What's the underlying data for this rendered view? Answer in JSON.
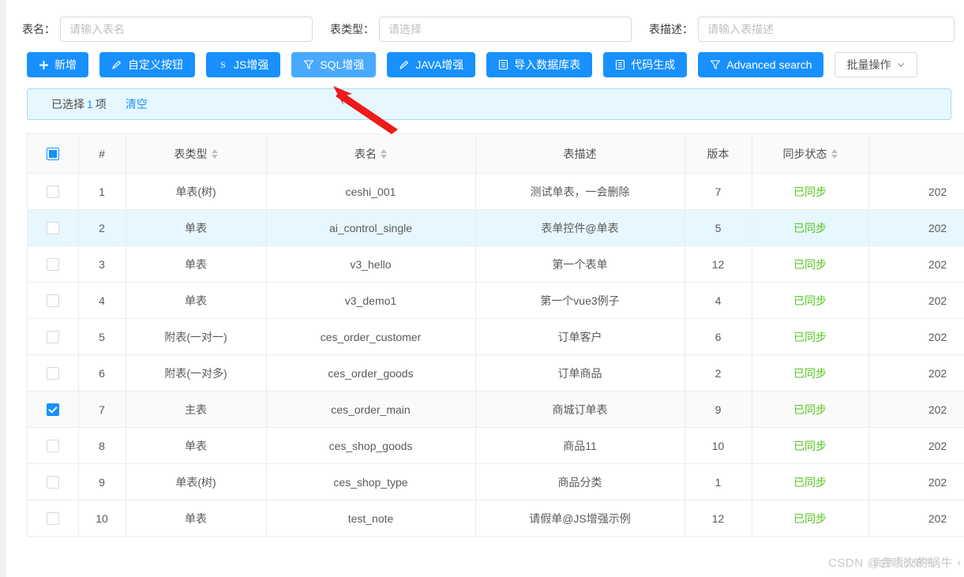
{
  "search_form": {
    "fields": [
      {
        "label": "表名：",
        "placeholder": "请输入表名",
        "value": "",
        "type": "input"
      },
      {
        "label": "表类型：",
        "placeholder": "请选择",
        "value": "",
        "type": "select"
      },
      {
        "label": "表描述：",
        "placeholder": "请输入表描述",
        "value": "",
        "type": "input"
      }
    ]
  },
  "toolbar": {
    "buttons": [
      {
        "label": "新增",
        "icon": "plus-icon",
        "style": "primary"
      },
      {
        "label": "自定义按钮",
        "icon": "pencil-icon",
        "style": "primary"
      },
      {
        "label": "JS增强",
        "icon": "s-icon",
        "style": "primary"
      },
      {
        "label": "SQL增强",
        "icon": "filter-icon",
        "style": "primary-hover"
      },
      {
        "label": "JAVA增强",
        "icon": "pencil-icon",
        "style": "primary"
      },
      {
        "label": "导入数据库表",
        "icon": "database-icon",
        "style": "primary"
      },
      {
        "label": "代码生成",
        "icon": "database-icon",
        "style": "primary"
      },
      {
        "label": "Advanced search",
        "icon": "filter-icon",
        "style": "primary"
      },
      {
        "label": "批量操作",
        "icon": "chevron-down-icon",
        "style": "default"
      }
    ]
  },
  "selection_alert": {
    "prefix": "已选择",
    "count": "1",
    "suffix": "项",
    "clear_label": "清空",
    "accent_color": "#1890ff",
    "background_color": "#e6f7ff"
  },
  "table": {
    "header_checkbox_state": "indeterminate",
    "columns": [
      {
        "key": "checkbox",
        "label": "",
        "sortable": false
      },
      {
        "key": "index",
        "label": "#",
        "sortable": false
      },
      {
        "key": "table_type",
        "label": "表类型",
        "sortable": true
      },
      {
        "key": "table_name",
        "label": "表名",
        "sortable": true
      },
      {
        "key": "table_desc",
        "label": "表描述",
        "sortable": false
      },
      {
        "key": "version",
        "label": "版本",
        "sortable": false
      },
      {
        "key": "sync_status",
        "label": "同步状态",
        "sortable": true
      },
      {
        "key": "date",
        "label": "",
        "sortable": false
      }
    ],
    "sync_ok_color": "#52c41a",
    "rows": [
      {
        "index": "1",
        "table_type": "单表(树)",
        "table_name": "ceshi_001",
        "table_desc": "测试单表，一会删除",
        "version": "7",
        "sync_status": "已同步",
        "date": "202",
        "checked": false,
        "state": ""
      },
      {
        "index": "2",
        "table_type": "单表",
        "table_name": "ai_control_single",
        "table_desc": "表单控件@单表",
        "version": "5",
        "sync_status": "已同步",
        "date": "202",
        "checked": false,
        "state": "hover"
      },
      {
        "index": "3",
        "table_type": "单表",
        "table_name": "v3_hello",
        "table_desc": "第一个表单",
        "version": "12",
        "sync_status": "已同步",
        "date": "202",
        "checked": false,
        "state": ""
      },
      {
        "index": "4",
        "table_type": "单表",
        "table_name": "v3_demo1",
        "table_desc": "第一个vue3例子",
        "version": "4",
        "sync_status": "已同步",
        "date": "202",
        "checked": false,
        "state": ""
      },
      {
        "index": "5",
        "table_type": "附表(一对一)",
        "table_name": "ces_order_customer",
        "table_desc": "订单客户",
        "version": "6",
        "sync_status": "已同步",
        "date": "202",
        "checked": false,
        "state": ""
      },
      {
        "index": "6",
        "table_type": "附表(一对多)",
        "table_name": "ces_order_goods",
        "table_desc": "订单商品",
        "version": "2",
        "sync_status": "已同步",
        "date": "202",
        "checked": false,
        "state": ""
      },
      {
        "index": "7",
        "table_type": "主表",
        "table_name": "ces_order_main",
        "table_desc": "商城订单表",
        "version": "9",
        "sync_status": "已同步",
        "date": "202",
        "checked": true,
        "state": "selected"
      },
      {
        "index": "8",
        "table_type": "单表",
        "table_name": "ces_shop_goods",
        "table_desc": "商品11",
        "version": "10",
        "sync_status": "已同步",
        "date": "202",
        "checked": false,
        "state": ""
      },
      {
        "index": "9",
        "table_type": "单表(树)",
        "table_name": "ces_shop_type",
        "table_desc": "商品分类",
        "version": "1",
        "sync_status": "已同步",
        "date": "202",
        "checked": false,
        "state": ""
      },
      {
        "index": "10",
        "table_type": "单表",
        "table_name": "test_note",
        "table_desc": "请假单@JS增强示例",
        "version": "12",
        "sync_status": "已同步",
        "date": "202",
        "checked": false,
        "state": ""
      }
    ]
  },
  "annotation": {
    "arrow_color": "#ee1b1b",
    "points_to": "SQL增强"
  },
  "watermark": {
    "text": "CSDN @会喷火的蜗牛",
    "overlay_text": "会喷火的蜗牛",
    "chevron": "‹"
  }
}
